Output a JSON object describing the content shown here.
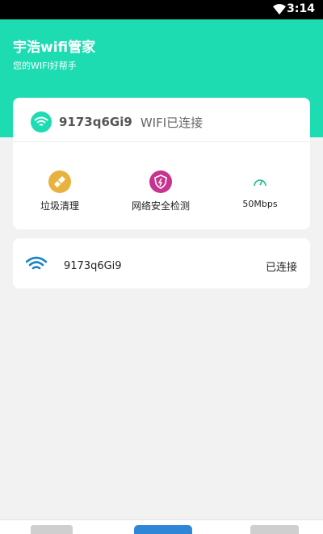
{
  "status_bar": {
    "time": "3:14"
  },
  "header": {
    "title": "宇浩wifi管家",
    "subtitle": "您的WIFI好帮手"
  },
  "connection": {
    "ssid": "9173q6Gi9",
    "status": "WIFI已连接"
  },
  "actions": [
    {
      "label": "垃圾清理",
      "icon": "broom-icon",
      "color": "#e9b23e"
    },
    {
      "label": "网络安全检测",
      "icon": "shield-icon",
      "color": "#c8338f"
    },
    {
      "label": "50Mbps",
      "icon": "speedometer-icon",
      "color": "#1db98f"
    }
  ],
  "networks": [
    {
      "ssid": "9173q6Gi9",
      "status": "已连接",
      "icon": "wifi-icon",
      "color": "#1a84c4"
    }
  ],
  "tabs": [
    {
      "icon": "tab-icon-left"
    },
    {
      "icon": "tab-icon-middle",
      "active": true
    },
    {
      "icon": "tab-icon-right"
    }
  ]
}
